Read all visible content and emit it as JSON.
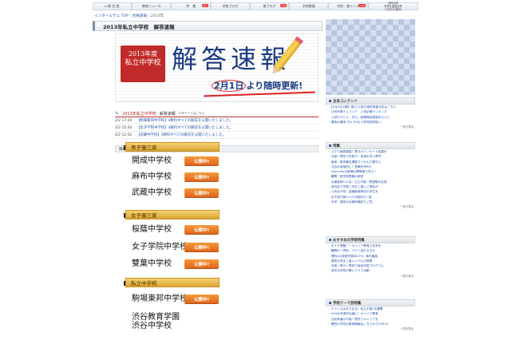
{
  "nav": [
    {
      "label": "▸ 総 合 版",
      "new": false
    },
    {
      "label": "教育ニュース",
      "new": false
    },
    {
      "label": "特　集",
      "new": true
    },
    {
      "label": "学校ブログ",
      "new": false
    },
    {
      "label": "塾ブログ",
      "new": true
    },
    {
      "label": "学校動画",
      "new": false
    },
    {
      "label": "学校・塾リンク",
      "new": true
    }
  ],
  "nav_new_label": "new",
  "nav_last": {
    "line1": "資料請求",
    "line2": "学校を直接請求",
    "line3": "できます(無料)"
  },
  "breadcrumb": {
    "home": "インターエデュ TOP",
    "sep1": "›",
    "section": "合格速報",
    "sep2": "›",
    "current": "2013年"
  },
  "page_title": "2013年私立中学校　解答速報",
  "banner": {
    "badge_line1": "2013年度",
    "badge_line2": "私立中学校",
    "title": "解答速報",
    "update_date": "2月1日",
    "update_text": "より随時更新!"
  },
  "news": {
    "header_red": "2013年私立中学校",
    "header": "解答速報",
    "header_link": "TOPページはこちら",
    "rows": [
      {
        "time": "2/2  17:20",
        "text": "【駒場東邦中学校】4教科すべての解答を公開いたしました。"
      },
      {
        "time": "2/2  15:44",
        "text": "【女子学院中学校】4教科すべての解答を公開いたしました。"
      },
      {
        "time": "2/2  12:52",
        "text": "【武蔵中学校】4教科すべての解答を公開いたしました。"
      }
    ]
  },
  "published_header": "掲載校",
  "groups": [
    {
      "label": "男子御三家",
      "schools": [
        {
          "name": "開成中学校",
          "button": "公開中!"
        },
        {
          "name": "麻布中学校",
          "button": "公開中!"
        },
        {
          "name": "武蔵中学校",
          "button": "公開中!"
        }
      ]
    },
    {
      "label": "女子御三家",
      "schools": [
        {
          "name": "桜蔭中学校",
          "button": "公開中!"
        },
        {
          "name": "女子学院中学校",
          "button": "公開中!"
        },
        {
          "name": "雙葉中学校",
          "button": "公開中!"
        }
      ]
    },
    {
      "label": "私立中学校",
      "schools": [
        {
          "name": "駒場東邦中学校",
          "button": "公開中!"
        },
        {
          "name": "渋谷教育学園",
          "button": ""
        },
        {
          "name": "渋谷中学校",
          "button": ""
        }
      ]
    }
  ],
  "sidebar": {
    "boxes": [
      {
        "title": "注目コンテンツ",
        "items": [
          "【2月3日公開】都立11校の適性検査分析はこちら",
          "日本科挙デェコリア　人気記事ランキング",
          "入試だけじゃ、学力。新聞検定調査をもとに",
          "最後の最後【91.9%】の学校説明会へ"
        ],
        "more": "一覧を見る"
      },
      {
        "title": "特集",
        "items": [
          "スマホ家庭調査！驚きのアンケート結果が",
          "中高一貫校で先取り！英語を学ぶ専門",
          "面接・新体験生講座でつかんだ勝ちに",
          "注目の地域別に！受験を有利に",
          "inter-eduの医療公開授業で学ぶ！",
          "難関・医学部受験の秘密",
          "合格者数112名！公立中高一貫受験を目指",
          "世田谷で学習と先生と強いご家族が",
          "人気女子校！高偏差値専攻の学生を",
          "女子部口家A+15分圏内の一覧",
          "中学・高校の合格体験記もご覧"
        ],
        "more": "一覧を見る"
      },
      {
        "title": "おすすめの学校特集",
        "items": [
          "中３で受験！？キャリア教育で未来を",
          "難関の一貫校、パワー溢れる日々",
          "理科4大英語学習88.3%！都内最高",
          "優秀な学生と高いレベルの授業",
          "中高一貫の一貫校で独自学習プログラム",
          "多彩な学校行事とクラブ活動"
        ],
        "more": "一覧を見る"
      },
      {
        "title": "学校テーマ別特集",
        "items": [
          "チャンスはまだある！私立中高2次募集",
          "H24大学進学合格に！キャリア教育",
          "文武両道の中高一貫校でキャリアを",
          "関西の学校の教育情報はこちらからCHECK"
        ],
        "more": "一覧を見る"
      }
    ]
  }
}
